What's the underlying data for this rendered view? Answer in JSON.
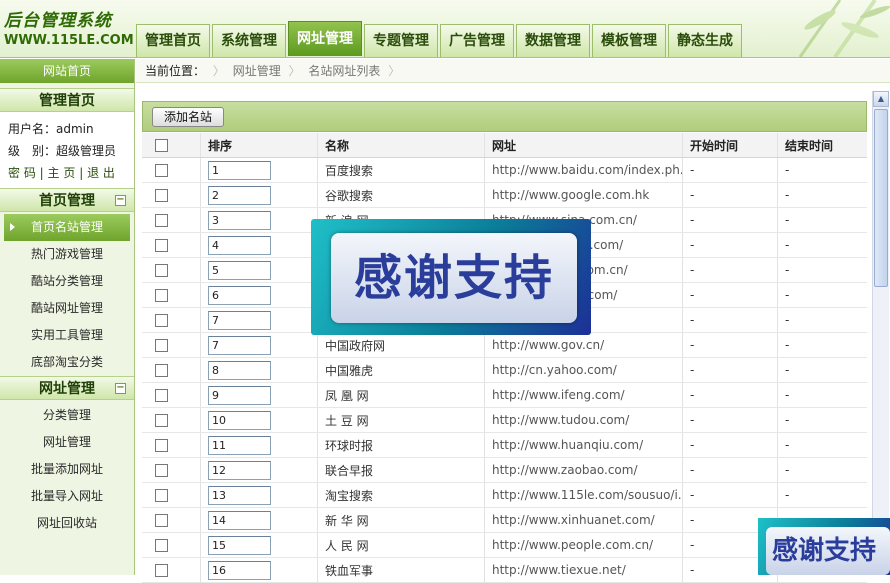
{
  "header": {
    "logo_line1": "后台管理系统",
    "logo_line2": "WWW.115LE.COM",
    "tabs": [
      {
        "label": "管理首页"
      },
      {
        "label": "系统管理"
      },
      {
        "label": "网址管理"
      },
      {
        "label": "专题管理"
      },
      {
        "label": "广告管理"
      },
      {
        "label": "数据管理"
      },
      {
        "label": "模板管理"
      },
      {
        "label": "静态生成"
      }
    ],
    "active_tab": "网址管理"
  },
  "sidebar": {
    "home_link": "网站首页",
    "section_admin": "管理首页",
    "user": {
      "username_line": "用户名：admin",
      "level_line": "级　别：超级管理员",
      "link_password": "密 码",
      "link_home": "主 页",
      "link_logout": "退 出",
      "sep": "|"
    },
    "section_home": "首页管理",
    "home_items": [
      "首页名站管理",
      "热门游戏管理",
      "酷站分类管理",
      "酷站网址管理",
      "实用工具管理",
      "底部淘宝分类"
    ],
    "active_item": "首页名站管理",
    "section_url": "网址管理",
    "url_items": [
      "分类管理",
      "网址管理",
      "批量添加网址",
      "批量导入网址",
      "网址回收站"
    ],
    "collapse_glyph": "−"
  },
  "breadcrumb": {
    "label": "当前位置：",
    "items": [
      "网址管理",
      "名站网址列表"
    ],
    "sep": "〉"
  },
  "toolbar": {
    "add_label": "添加名站"
  },
  "table": {
    "headers": [
      "",
      "排序",
      "名称",
      "网址",
      "开始时间",
      "结束时间"
    ],
    "rows": [
      {
        "order": "1",
        "name": "百度搜索",
        "url": "http://www.baidu.com/index.ph...",
        "start": "-",
        "end": "-"
      },
      {
        "order": "2",
        "name": "谷歌搜索",
        "url": "http://www.google.com.hk",
        "start": "-",
        "end": "-"
      },
      {
        "order": "3",
        "name": "新 浪 网",
        "url": "http://www.sina.com.cn/",
        "start": "-",
        "end": "-"
      },
      {
        "order": "4",
        "name": "",
        "url": "http://www.sohu.com/",
        "start": "-",
        "end": "-"
      },
      {
        "order": "5",
        "name": "",
        "url": "http://www.qq.com.cn/",
        "start": "-",
        "end": "-"
      },
      {
        "order": "6",
        "name": "",
        "url": "http://www.163.com/",
        "start": "-",
        "end": "-"
      },
      {
        "order": "7",
        "name": "",
        "url": "",
        "start": "-",
        "end": "-"
      },
      {
        "order": "7",
        "name": "中国政府网",
        "url": "http://www.gov.cn/",
        "start": "-",
        "end": "-"
      },
      {
        "order": "8",
        "name": "中国雅虎",
        "url": "http://cn.yahoo.com/",
        "start": "-",
        "end": "-"
      },
      {
        "order": "9",
        "name": "凤 凰 网",
        "url": "http://www.ifeng.com/",
        "start": "-",
        "end": "-"
      },
      {
        "order": "10",
        "name": "土 豆 网",
        "url": "http://www.tudou.com/",
        "start": "-",
        "end": "-"
      },
      {
        "order": "11",
        "name": "环球时报",
        "url": "http://www.huanqiu.com/",
        "start": "-",
        "end": "-"
      },
      {
        "order": "12",
        "name": "联合早报",
        "url": "http://www.zaobao.com/",
        "start": "-",
        "end": "-"
      },
      {
        "order": "13",
        "name": "淘宝搜索",
        "url": "http://www.115le.com/sousuo/i...",
        "start": "-",
        "end": "-"
      },
      {
        "order": "14",
        "name": "新 华 网",
        "url": "http://www.xinhuanet.com/",
        "start": "-",
        "end": "-"
      },
      {
        "order": "15",
        "name": "人 民 网",
        "url": "http://www.people.com.cn/",
        "start": "-",
        "end": "-"
      },
      {
        "order": "16",
        "name": "铁血军事",
        "url": "http://www.tiexue.net/",
        "start": "-",
        "end": "-"
      }
    ]
  },
  "watermark": {
    "text": "感谢支持"
  },
  "colors": {
    "brand_green": "#6fa42c",
    "tab_active": "#5c9a1e",
    "toolbar": "#b0cd7c"
  }
}
